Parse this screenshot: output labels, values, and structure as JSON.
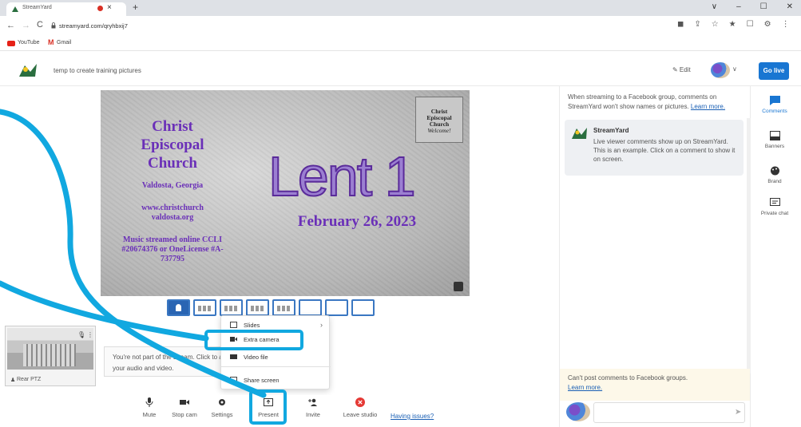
{
  "browser": {
    "tab_title": "StreamYard",
    "tab_close": "×",
    "new_tab": "+",
    "window_controls": [
      "∨",
      "–",
      "☐",
      "✕"
    ],
    "nav_back": "←",
    "nav_forward": "→",
    "nav_reload": "C",
    "url": "streamyard.com/qryhbxij7",
    "toolbar_icons": [
      "◼",
      "⇪",
      "☆",
      "★",
      "☐",
      "⚙",
      "⋮"
    ],
    "bookmarks": [
      {
        "label": "YouTube"
      },
      {
        "label": "Gmail",
        "icon": "M"
      }
    ]
  },
  "header": {
    "studio_title": "temp to create training pictures",
    "edit_label": "✎ Edit",
    "chevron": "∨",
    "go_live_label": "Go live"
  },
  "stage": {
    "church_name": "Christ Episcopal Church",
    "church_city": "Valdosta, Georgia",
    "church_web": "www.christchurch valdosta.org",
    "church_music": "Music streamed online CCLI #20674376 or OneLicense #A-737795",
    "title": "Lent 1",
    "date": "February 26, 2023",
    "badge": {
      "line1": "Christ",
      "line2": "Episcopal",
      "line3": "Church",
      "line4": "Welcome!"
    }
  },
  "guest": {
    "name": "Rear PTZ",
    "name_icon": "♟",
    "mic_icon": "🎙",
    "menu_icon": "⋮"
  },
  "notice": {
    "text": "You're not part of the stream. Click to add your audio and video."
  },
  "present_menu": {
    "items": [
      {
        "label": "Slides",
        "icon": "slides-icon"
      },
      {
        "label": "Extra camera",
        "icon": "camera-icon"
      },
      {
        "label": "Video file",
        "icon": "video-file-icon"
      },
      {
        "label": "Share screen",
        "icon": "share-screen-icon"
      }
    ],
    "slides_chevron": "›"
  },
  "controls": {
    "buttons": [
      {
        "label": "Mute",
        "icon": "mic-icon"
      },
      {
        "label": "Stop cam",
        "icon": "camera-icon"
      },
      {
        "label": "Settings",
        "icon": "gear-icon"
      },
      {
        "label": "Present",
        "icon": "present-icon"
      },
      {
        "label": "Invite",
        "icon": "add-person-icon"
      },
      {
        "label": "Leave studio",
        "icon": "close-circle-icon"
      }
    ],
    "issues_link": "Having issues?"
  },
  "comments": {
    "fb_note": "When streaming to a Facebook group, comments on StreamYard won't show names or pictures.",
    "fb_note_link": "Learn more.",
    "sample": {
      "name": "StreamYard",
      "text": "Live viewer comments show up on StreamYard. This is an example. Click on a comment to show it on screen."
    },
    "cant_post": "Can't post comments to Facebook groups.",
    "cant_post_link": "Learn more.",
    "send_icon": "➤"
  },
  "rail": {
    "items": [
      {
        "label": "Comments",
        "icon": "comment-icon"
      },
      {
        "label": "Banners",
        "icon": "banner-icon"
      },
      {
        "label": "Brand",
        "icon": "palette-icon"
      },
      {
        "label": "Private chat",
        "icon": "chat-icon"
      }
    ]
  },
  "colors": {
    "accent": "#1976d2",
    "annotation": "#11a8e0",
    "church_purple": "#6a2fb8",
    "leave_red": "#e53935"
  }
}
